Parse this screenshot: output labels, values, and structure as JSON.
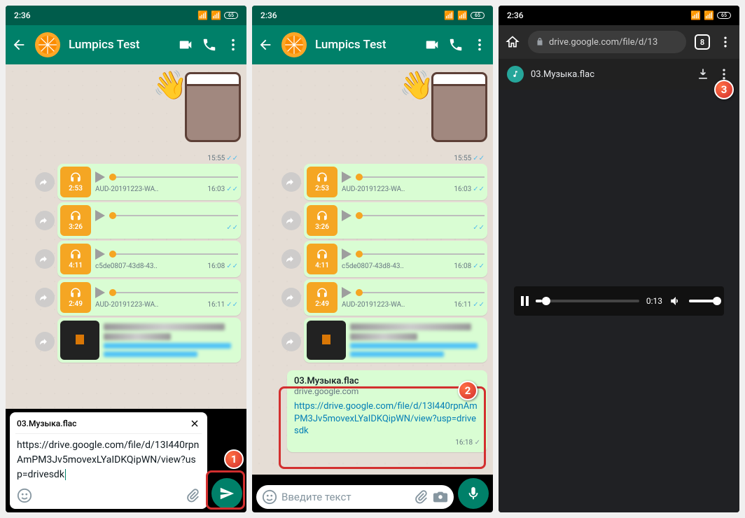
{
  "status_time": "2:36",
  "battery": "65",
  "chat": {
    "title": "Lumpics Test",
    "sticker_ts": "15:55",
    "audio": [
      {
        "dur": "2:53",
        "file": "AUD-20191223-WA..",
        "time": "16:03"
      },
      {
        "dur": "3:26",
        "file": "",
        "time": ""
      },
      {
        "dur": "4:11",
        "file": "c5de0807-43d8-43..",
        "time": "16:08"
      },
      {
        "dur": "2:49",
        "file": "AUD-20191223-WA..",
        "time": "16:11"
      }
    ]
  },
  "compose": {
    "preview_title": "03.Музыка.flac",
    "url_text": "https://drive.google.com/file/d/13I440rpnAmPM3Jv5movexLYaIDKQipWN/view?usp=drivesdk"
  },
  "sent_link": {
    "title": "03.Музыка.flac",
    "domain": "drive.google.com",
    "url": "https://drive.google.com/file/d/13I440rpnAmPM3Jv5movexLYaIDKQipWN/view?usp=drivesdk",
    "time": "16:18"
  },
  "input_placeholder": "Введите текст",
  "browser": {
    "url_display": "drive.google.com/file/d/13",
    "tab_count": "8",
    "file_name": "03.Музыка.flac",
    "play_time": "0:13"
  },
  "callouts": {
    "one": "1",
    "two": "2",
    "three": "3"
  }
}
